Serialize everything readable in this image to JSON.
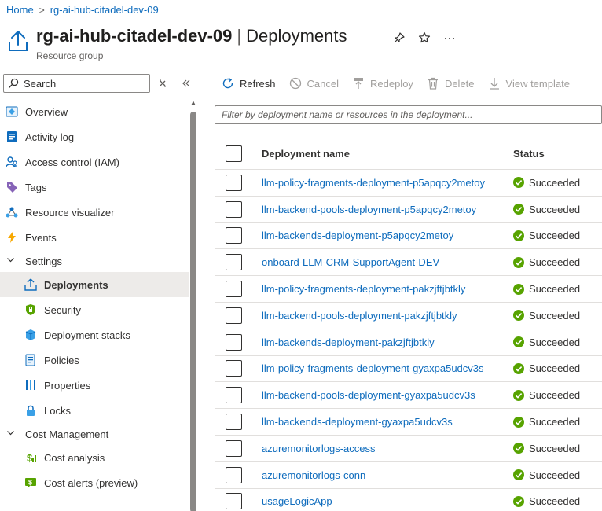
{
  "breadcrumb": {
    "home": "Home",
    "separator": ">",
    "current": "rg-ai-hub-citadel-dev-09"
  },
  "header": {
    "resource_name": "rg-ai-hub-citadel-dev-09",
    "separator": "|",
    "page": "Deployments",
    "subtitle": "Resource group",
    "pin_icon": "pin-icon",
    "favorite_icon": "star-icon",
    "more_icon": "more-icon"
  },
  "sidebar": {
    "search_placeholder": "Search",
    "items": [
      {
        "label": "Overview",
        "icon": "overview-icon"
      },
      {
        "label": "Activity log",
        "icon": "activity-log-icon"
      },
      {
        "label": "Access control (IAM)",
        "icon": "iam-icon"
      },
      {
        "label": "Tags",
        "icon": "tag-icon"
      },
      {
        "label": "Resource visualizer",
        "icon": "visualizer-icon"
      },
      {
        "label": "Events",
        "icon": "lightning-icon"
      },
      {
        "label": "Settings",
        "icon": "chevron-down-icon"
      },
      {
        "label": "Deployments",
        "icon": "deployments-icon"
      },
      {
        "label": "Security",
        "icon": "shield-icon"
      },
      {
        "label": "Deployment stacks",
        "icon": "cube-icon"
      },
      {
        "label": "Policies",
        "icon": "policy-icon"
      },
      {
        "label": "Properties",
        "icon": "properties-icon"
      },
      {
        "label": "Locks",
        "icon": "lock-icon"
      },
      {
        "label": "Cost Management",
        "icon": "chevron-down-icon"
      },
      {
        "label": "Cost analysis",
        "icon": "cost-analysis-icon"
      },
      {
        "label": "Cost alerts (preview)",
        "icon": "cost-alert-icon"
      }
    ]
  },
  "toolbar": {
    "refresh": "Refresh",
    "cancel": "Cancel",
    "redeploy": "Redeploy",
    "delete": "Delete",
    "view_template": "View template"
  },
  "filter": {
    "placeholder": "Filter by deployment name or resources in the deployment..."
  },
  "table": {
    "columns": {
      "name": "Deployment name",
      "status": "Status"
    },
    "rows": [
      {
        "name": "llm-policy-fragments-deployment-p5apqcy2metoy",
        "status": "Succeeded"
      },
      {
        "name": "llm-backend-pools-deployment-p5apqcy2metoy",
        "status": "Succeeded"
      },
      {
        "name": "llm-backends-deployment-p5apqcy2metoy",
        "status": "Succeeded"
      },
      {
        "name": "onboard-LLM-CRM-SupportAgent-DEV",
        "status": "Succeeded"
      },
      {
        "name": "llm-policy-fragments-deployment-pakzjftjbtkly",
        "status": "Succeeded"
      },
      {
        "name": "llm-backend-pools-deployment-pakzjftjbtkly",
        "status": "Succeeded"
      },
      {
        "name": "llm-backends-deployment-pakzjftjbtkly",
        "status": "Succeeded"
      },
      {
        "name": "llm-policy-fragments-deployment-gyaxpa5udcv3s",
        "status": "Succeeded"
      },
      {
        "name": "llm-backend-pools-deployment-gyaxpa5udcv3s",
        "status": "Succeeded"
      },
      {
        "name": "llm-backends-deployment-gyaxpa5udcv3s",
        "status": "Succeeded"
      },
      {
        "name": "azuremonitorlogs-access",
        "status": "Succeeded"
      },
      {
        "name": "azuremonitorlogs-conn",
        "status": "Succeeded"
      },
      {
        "name": "usageLogicApp",
        "status": "Succeeded"
      }
    ]
  },
  "colors": {
    "link": "#0f6cbd",
    "success": "#57a300",
    "selected_bg": "#edebe9"
  }
}
